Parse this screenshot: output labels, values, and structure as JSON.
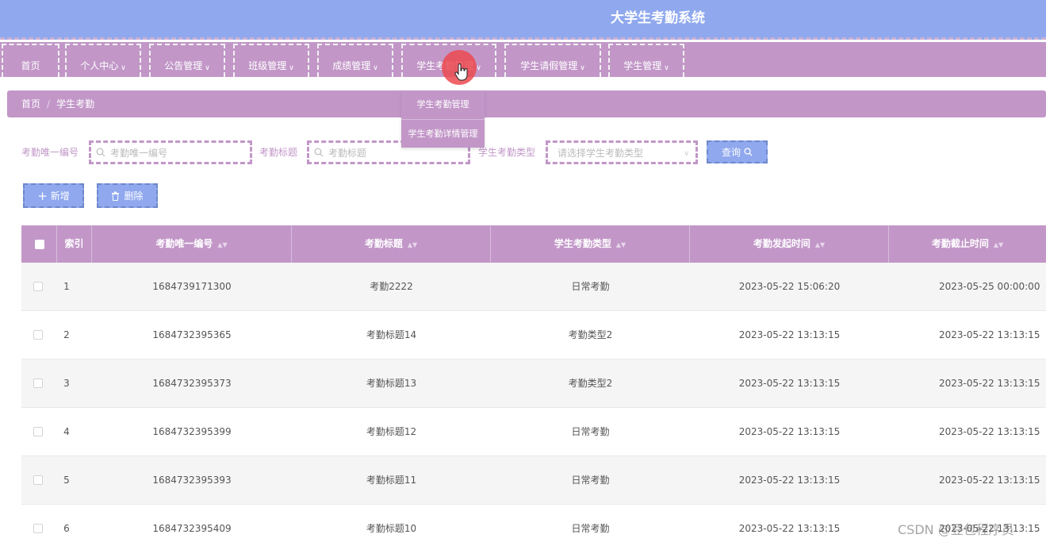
{
  "app": {
    "title": "大学生考勤系统"
  },
  "nav": {
    "items": [
      {
        "label": "首页",
        "has_dropdown": false
      },
      {
        "label": "个人中心",
        "has_dropdown": true
      },
      {
        "label": "公告管理",
        "has_dropdown": true
      },
      {
        "label": "班级管理",
        "has_dropdown": true
      },
      {
        "label": "成绩管理",
        "has_dropdown": true
      },
      {
        "label": "学生考勤管理",
        "has_dropdown": true
      },
      {
        "label": "学生请假管理",
        "has_dropdown": true
      },
      {
        "label": "学生管理",
        "has_dropdown": true
      }
    ],
    "dropdown_items": [
      "学生考勤管理",
      "学生考勤详情管理"
    ]
  },
  "breadcrumb": {
    "home": "首页",
    "current": "学生考勤"
  },
  "search": {
    "id_label": "考勤唯一编号",
    "id_placeholder": "考勤唯一编号",
    "title_label": "考勤标题",
    "title_placeholder": "考勤标题",
    "type_label": "学生考勤类型",
    "type_placeholder": "请选择学生考勤类型",
    "query_label": "查询"
  },
  "actions": {
    "add_label": "新增",
    "delete_label": "删除"
  },
  "table": {
    "columns": [
      "索引",
      "考勤唯一编号",
      "考勤标题",
      "学生考勤类型",
      "考勤发起时间",
      "考勤截止时间"
    ],
    "rows": [
      {
        "index": "1",
        "id": "1684739171300",
        "title": "考勤2222",
        "type": "日常考勤",
        "start": "2023-05-22 15:06:20",
        "end": "2023-05-25 00:00:00"
      },
      {
        "index": "2",
        "id": "1684732395365",
        "title": "考勤标题14",
        "type": "考勤类型2",
        "start": "2023-05-22 13:13:15",
        "end": "2023-05-22 13:13:15"
      },
      {
        "index": "3",
        "id": "1684732395373",
        "title": "考勤标题13",
        "type": "考勤类型2",
        "start": "2023-05-22 13:13:15",
        "end": "2023-05-22 13:13:15"
      },
      {
        "index": "4",
        "id": "1684732395399",
        "title": "考勤标题12",
        "type": "日常考勤",
        "start": "2023-05-22 13:13:15",
        "end": "2023-05-22 13:13:15"
      },
      {
        "index": "5",
        "id": "1684732395393",
        "title": "考勤标题11",
        "type": "日常考勤",
        "start": "2023-05-22 13:13:15",
        "end": "2023-05-22 13:13:15"
      },
      {
        "index": "6",
        "id": "1684732395409",
        "title": "考勤标题10",
        "type": "日常考勤",
        "start": "2023-05-22 13:13:15",
        "end": "2023-05-22 13:13:15"
      }
    ]
  },
  "watermark": "CSDN @豆包程序员",
  "colors": {
    "header": "#8fa8ee",
    "accent": "#c297c8",
    "button": "#8fa8ee"
  }
}
